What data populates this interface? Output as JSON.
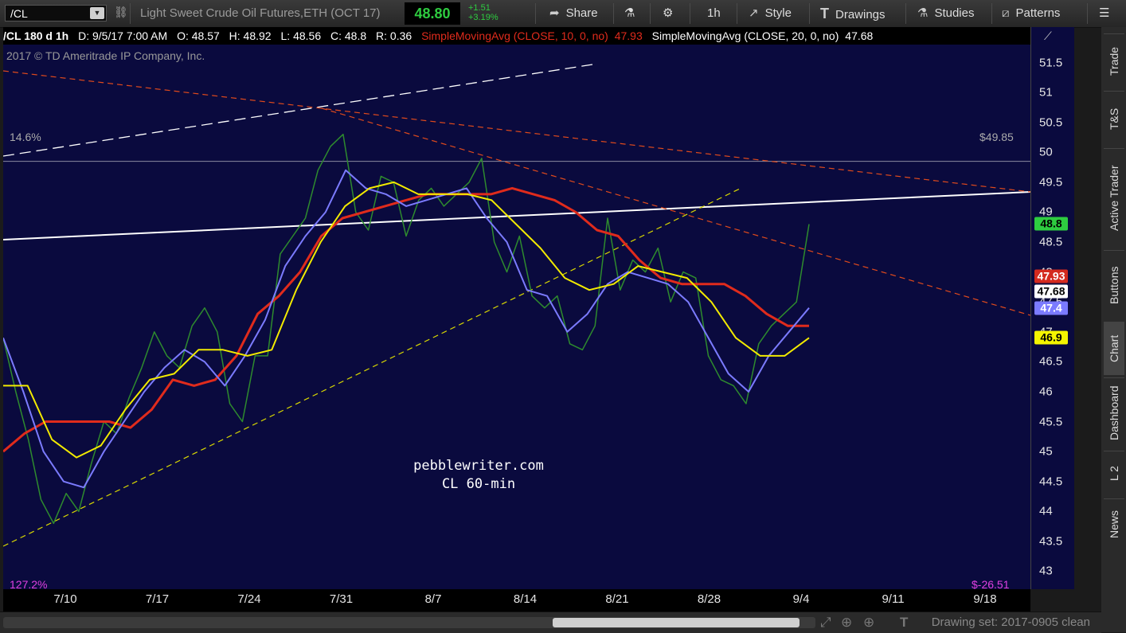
{
  "toolbar": {
    "symbol": "/CL",
    "link_icon": "link-icon",
    "title": "Light Sweet Crude Oil Futures,ETH (OCT 17)",
    "last_price": "48.80",
    "change_abs": "+1.51",
    "change_pct": "+3.19%",
    "share_label": "Share",
    "timeframe_label": "1h",
    "style_label": "Style",
    "drawings_label": "Drawings",
    "studies_label": "Studies",
    "patterns_label": "Patterns",
    "price_color": "#2ecc40"
  },
  "info_bar": {
    "symbol_period": "/CL 180 d 1h",
    "date": "D: 9/5/17 7:00 AM",
    "open": "O: 48.57",
    "high": "H: 48.92",
    "low": "L: 48.56",
    "close": "C: 48.8",
    "range": "R: 0.36",
    "sma10_label": "SimpleMovingAvg (CLOSE, 10, 0, no)",
    "sma10_value": "47.93",
    "sma20_label": "SimpleMovingAvg (CLOSE, 20, 0, no)",
    "sma20_value": "47.68"
  },
  "chart": {
    "watermark": "2017 © TD Ameritrade IP Company, Inc.",
    "fib_top_left": "14.6%",
    "fib_top_right": "$49.85",
    "fib_bottom_left": "127.2%",
    "fib_bottom_right": "$-26.51",
    "annotation_line1": "pebblewriter.com",
    "annotation_line2": "CL 60-min"
  },
  "chart_data": {
    "type": "line",
    "title": "",
    "xlabel": "",
    "ylabel": "",
    "ylim": [
      42.7,
      51.8
    ],
    "y_ticks": [
      "51.5",
      "51",
      "50.5",
      "50",
      "49.5",
      "49",
      "48.5",
      "48",
      "47.5",
      "47",
      "46.5",
      "46",
      "45.5",
      "45",
      "44.5",
      "44",
      "43.5",
      "43"
    ],
    "x_ticks": [
      "7/10",
      "7/17",
      "7/24",
      "7/31",
      "8/7",
      "8/14",
      "8/21",
      "8/28",
      "9/4",
      "9/11",
      "9/18"
    ],
    "price_tags": [
      {
        "label": "48.8",
        "value": 48.8,
        "bg": "#2ecc40",
        "fg": "#000"
      },
      {
        "label": "47.93",
        "value": 47.93,
        "bg": "#d42a1e",
        "fg": "#fff"
      },
      {
        "label": "47.68",
        "value": 47.68,
        "bg": "#ffffff",
        "fg": "#000"
      },
      {
        "label": "47.4",
        "value": 47.4,
        "bg": "#7b7bff",
        "fg": "#fff"
      },
      {
        "label": "46.9",
        "value": 46.9,
        "bg": "#f5f500",
        "fg": "#000"
      }
    ],
    "fib_level": 49.85,
    "series": [
      {
        "name": "price",
        "color": "#2e8b2e",
        "values": [
          46.9,
          46.0,
          45.2,
          44.2,
          43.8,
          44.3,
          44.0,
          44.8,
          45.5,
          45.3,
          45.9,
          46.4,
          47.0,
          46.6,
          46.4,
          47.1,
          47.4,
          47.0,
          45.8,
          45.5,
          46.6,
          46.6,
          48.3,
          48.6,
          48.9,
          49.7,
          50.1,
          50.3,
          49.0,
          48.7,
          49.6,
          49.5,
          48.6,
          49.2,
          49.4,
          49.1,
          49.3,
          49.5,
          49.9,
          48.5,
          48.0,
          48.6,
          47.6,
          47.4,
          47.6,
          46.8,
          46.7,
          47.1,
          48.9,
          47.7,
          48.2,
          48.0,
          48.4,
          47.5,
          48.0,
          47.9,
          46.6,
          46.2,
          46.1,
          45.8,
          46.8,
          47.1,
          47.3,
          47.5,
          48.8
        ]
      },
      {
        "name": "SimpleMovingAvg (CLOSE, 10, 0, no)",
        "color": "#e02b1c",
        "values": [
          45.0,
          45.3,
          45.5,
          45.5,
          45.5,
          45.5,
          45.4,
          45.7,
          46.2,
          46.1,
          46.2,
          46.6,
          47.3,
          47.6,
          48.0,
          48.6,
          48.9,
          49.0,
          49.1,
          49.2,
          49.3,
          49.3,
          49.3,
          49.3,
          49.4,
          49.3,
          49.2,
          49.0,
          48.7,
          48.6,
          48.2,
          47.9,
          47.8,
          47.8,
          47.8,
          47.6,
          47.3,
          47.1,
          47.1
        ]
      },
      {
        "name": "SimpleMovingAvg (CLOSE, 20, 0, no)",
        "color": "#7b7bff",
        "values": [
          46.9,
          46.0,
          45.0,
          44.5,
          44.4,
          45.0,
          45.5,
          46.0,
          46.4,
          46.7,
          46.5,
          46.1,
          46.6,
          47.2,
          48.1,
          48.6,
          49.0,
          49.7,
          49.4,
          49.3,
          49.1,
          49.2,
          49.3,
          49.4,
          48.9,
          48.5,
          47.7,
          47.6,
          47.0,
          47.3,
          47.8,
          48.0,
          47.9,
          47.8,
          47.5,
          46.9,
          46.3,
          46.0,
          46.6,
          47.0,
          47.4
        ]
      },
      {
        "name": "",
        "color": "#f2ea00",
        "values": [
          46.1,
          46.1,
          45.2,
          44.9,
          45.1,
          45.7,
          46.2,
          46.3,
          46.7,
          46.7,
          46.6,
          46.7,
          47.7,
          48.5,
          49.1,
          49.4,
          49.5,
          49.3,
          49.3,
          49.3,
          49.2,
          48.8,
          48.4,
          47.9,
          47.7,
          47.8,
          48.1,
          48.0,
          47.9,
          47.5,
          46.9,
          46.6,
          46.6,
          46.9
        ]
      }
    ]
  },
  "right_panel": {
    "tabs": [
      "Trade",
      "T&S",
      "Active Trader",
      "Buttons",
      "Chart",
      "Dashboard",
      "L 2",
      "News"
    ]
  },
  "bottom_bar": {
    "drawing_set": "Drawing set: 2017-0905 clean"
  }
}
